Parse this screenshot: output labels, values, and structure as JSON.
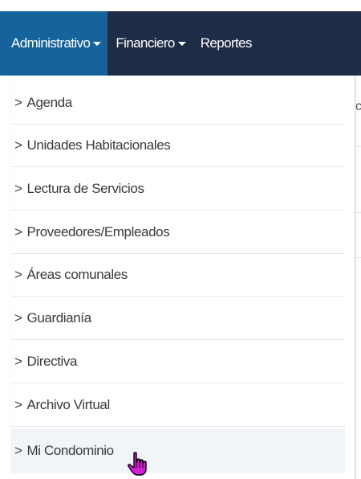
{
  "navbar": {
    "items": [
      {
        "label": "Administrativo",
        "has_caret": true,
        "active": true
      },
      {
        "label": "Financiero",
        "has_caret": true,
        "active": false
      },
      {
        "label": "Reportes",
        "has_caret": false,
        "active": false
      }
    ]
  },
  "dropdown": {
    "items": [
      {
        "label": "Agenda"
      },
      {
        "label": "Unidades Habitacionales"
      },
      {
        "label": "Lectura de Servicios"
      },
      {
        "label": "Proveedores/Empleados"
      },
      {
        "label": "Áreas comunales"
      },
      {
        "label": "Guardianía"
      },
      {
        "label": "Directiva"
      },
      {
        "label": "Archivo Virtual"
      },
      {
        "label": "Mi Condominio"
      }
    ],
    "chevron": ">"
  },
  "background": {
    "partial_text": "c"
  },
  "colors": {
    "navbar_bg": "#1f2c47",
    "active_tab_bg": "#15639a",
    "hover_row_bg": "#f2f5f8"
  }
}
